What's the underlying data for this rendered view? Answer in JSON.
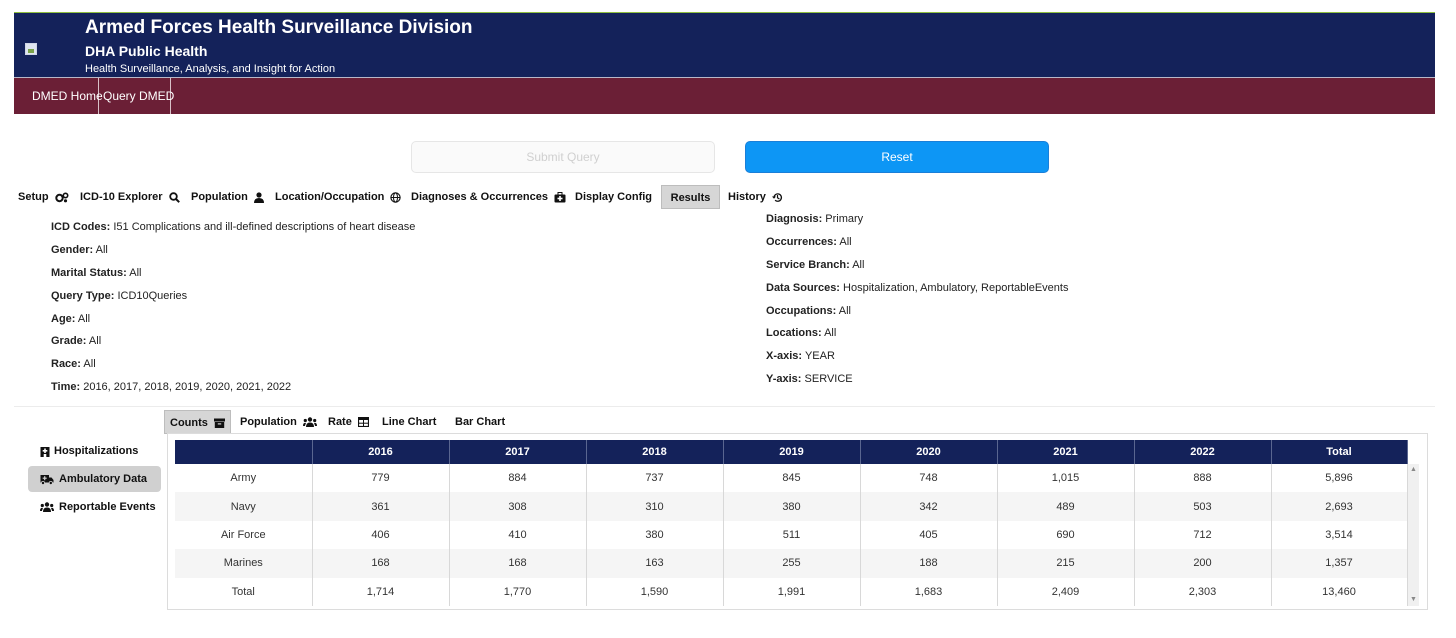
{
  "header": {
    "title": "Armed Forces Health Surveillance Division",
    "subtitle": "DHA Public Health",
    "tagline": "Health Surveillance, Analysis, and Insight for Action",
    "colors": {
      "header_bg": "#14225a",
      "nav_bg": "#6b1f36",
      "accent_line": "#8fbf3f"
    }
  },
  "nav": {
    "home": "DMED Home",
    "query": "Query DMED"
  },
  "actions": {
    "submit": "Submit Query",
    "reset": "Reset",
    "reset_color": "#0d96f5"
  },
  "tabs": [
    {
      "label": "Setup",
      "icon": "gears-icon"
    },
    {
      "label": "ICD-10 Explorer",
      "icon": "search-icon"
    },
    {
      "label": "Population",
      "icon": "user-icon"
    },
    {
      "label": "Location/Occupation",
      "icon": "globe-icon"
    },
    {
      "label": "Diagnoses & Occurrences",
      "icon": "medkit-icon"
    },
    {
      "label": "Display Config"
    },
    {
      "label": "Results",
      "active": true
    },
    {
      "label": "History",
      "icon": "history-icon"
    }
  ],
  "summary": {
    "left": [
      {
        "label": "ICD Codes:",
        "value": "I51 Complications and ill-defined descriptions of heart disease"
      },
      {
        "label": "Gender:",
        "value": "All"
      },
      {
        "label": "Marital Status:",
        "value": "All"
      },
      {
        "label": "Query Type:",
        "value": "ICD10Queries"
      },
      {
        "label": "Age:",
        "value": "All"
      },
      {
        "label": "Grade:",
        "value": "All"
      },
      {
        "label": "Race:",
        "value": "All"
      },
      {
        "label": "Time:",
        "value": "2016, 2017, 2018, 2019, 2020, 2021, 2022"
      }
    ],
    "right": [
      {
        "label": "Diagnosis:",
        "value": "Primary"
      },
      {
        "label": "Occurrences:",
        "value": "All"
      },
      {
        "label": "Service Branch:",
        "value": "All"
      },
      {
        "label": "Data Sources:",
        "value": "Hospitalization, Ambulatory, ReportableEvents"
      },
      {
        "label": "Occupations:",
        "value": "All"
      },
      {
        "label": "Locations:",
        "value": "All"
      },
      {
        "label": "X-axis:",
        "value": "YEAR"
      },
      {
        "label": "Y-axis:",
        "value": "SERVICE"
      }
    ]
  },
  "side": [
    {
      "label": "Hospitalizations",
      "icon": "hospital-icon"
    },
    {
      "label": "Ambulatory Data",
      "icon": "ambulance-icon",
      "active": true
    },
    {
      "label": "Reportable Events",
      "icon": "users-icon"
    }
  ],
  "subtabs": [
    {
      "label": "Counts",
      "icon": "archive-icon",
      "active": true
    },
    {
      "label": "Population",
      "icon": "users-icon"
    },
    {
      "label": "Rate",
      "icon": "table-icon"
    },
    {
      "label": "Line Chart"
    },
    {
      "label": "Bar Chart"
    }
  ],
  "table": {
    "columns": [
      "",
      "2016",
      "2017",
      "2018",
      "2019",
      "2020",
      "2021",
      "2022",
      "Total"
    ],
    "rows": [
      [
        "Army",
        "779",
        "884",
        "737",
        "845",
        "748",
        "1,015",
        "888",
        "5,896"
      ],
      [
        "Navy",
        "361",
        "308",
        "310",
        "380",
        "342",
        "489",
        "503",
        "2,693"
      ],
      [
        "Air Force",
        "406",
        "410",
        "380",
        "511",
        "405",
        "690",
        "712",
        "3,514"
      ],
      [
        "Marines",
        "168",
        "168",
        "163",
        "255",
        "188",
        "215",
        "200",
        "1,357"
      ],
      [
        "Total",
        "1,714",
        "1,770",
        "1,590",
        "1,991",
        "1,683",
        "2,409",
        "2,303",
        "13,460"
      ]
    ]
  }
}
